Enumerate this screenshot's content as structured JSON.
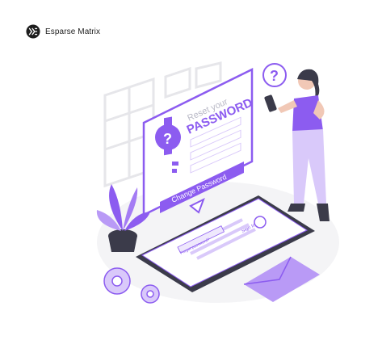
{
  "brand": {
    "logo_icon": "esparse-matrix-logo",
    "name": "Esparse Matrix"
  },
  "illustration": {
    "dialog_title_small": "Reset your",
    "dialog_title_large": "PASSWORD",
    "dialog_button": "Change Password",
    "phone_title": "Sign In",
    "phone_link": "Forgot password?",
    "question_mark": "?",
    "key_mark": "?"
  },
  "colors": {
    "accent": "#8c5cf0",
    "accent_light": "#d9c9fa",
    "accent_pale": "#efe8fd",
    "outline": "#3b3b4a"
  }
}
